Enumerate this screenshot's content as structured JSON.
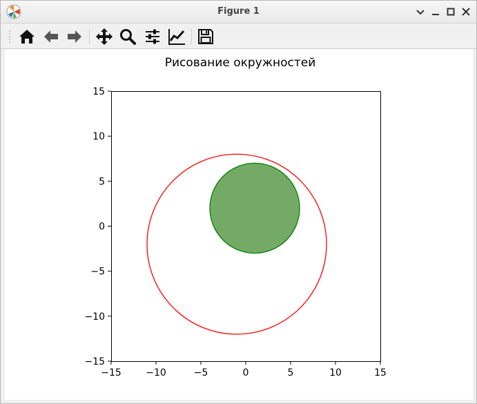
{
  "window": {
    "title": "Figure 1"
  },
  "toolbar": {
    "buttons": [
      {
        "icon": "home-icon",
        "tooltip": "Home"
      },
      {
        "icon": "back-arrow-icon",
        "tooltip": "Back"
      },
      {
        "icon": "forward-arrow-icon",
        "tooltip": "Forward"
      },
      {
        "icon": "pan-icon",
        "tooltip": "Pan"
      },
      {
        "icon": "zoom-icon",
        "tooltip": "Zoom"
      },
      {
        "icon": "subplots-icon",
        "tooltip": "Subplots"
      },
      {
        "icon": "edit-axis-icon",
        "tooltip": "Customize"
      },
      {
        "icon": "save-icon",
        "tooltip": "Save"
      }
    ]
  },
  "chart_data": {
    "type": "scatter",
    "title": "Рисование окружностей",
    "xlabel": "",
    "ylabel": "",
    "xlim": [
      -15,
      15
    ],
    "ylim": [
      -15,
      15
    ],
    "xticks": [
      -15,
      -10,
      -5,
      0,
      5,
      10,
      15
    ],
    "yticks": [
      -15,
      -10,
      -5,
      0,
      5,
      10,
      15
    ],
    "xtick_labels": [
      "−15",
      "−10",
      "−5",
      "0",
      "5",
      "10",
      "15"
    ],
    "ytick_labels": [
      "−15",
      "−10",
      "−5",
      "0",
      "5",
      "10",
      "15"
    ],
    "grid": false,
    "circles": [
      {
        "center": [
          -1,
          -2
        ],
        "radius": 10,
        "edgecolor": "#ff0000",
        "facecolor": "none",
        "filled": false
      },
      {
        "center": [
          1,
          2
        ],
        "radius": 5,
        "edgecolor": "#008000",
        "facecolor": "#75aa66",
        "filled": true
      }
    ]
  }
}
